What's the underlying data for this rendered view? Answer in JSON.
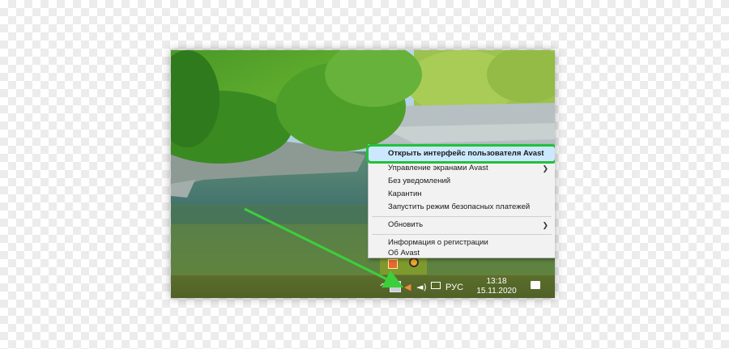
{
  "context_menu": {
    "items": [
      {
        "label": "Открыть интерфейс пользователя Avast",
        "submenu": false,
        "highlighted": true
      },
      {
        "label": "Управление экранами Avast",
        "submenu": true
      },
      {
        "label": "Без уведомлений",
        "submenu": false
      },
      {
        "label": "Карантин",
        "submenu": false
      },
      {
        "label": "Запустить режим безопасных платежей",
        "submenu": false
      },
      {
        "label": "Обновить",
        "submenu": true
      },
      {
        "label": "Информация о регистрации",
        "submenu": false
      },
      {
        "label": "Об Avast",
        "submenu": false
      }
    ],
    "highlight_color": "#22c03a"
  },
  "taskbar": {
    "language": "РУС",
    "time": "13:18",
    "date": "15.11.2020",
    "icons": [
      "show-hidden-icons",
      "avast-icon",
      "speaker-icon",
      "volume-icon",
      "network-icon",
      "notification-icon"
    ]
  },
  "annotation": {
    "arrow_color": "#3ccf3c"
  }
}
